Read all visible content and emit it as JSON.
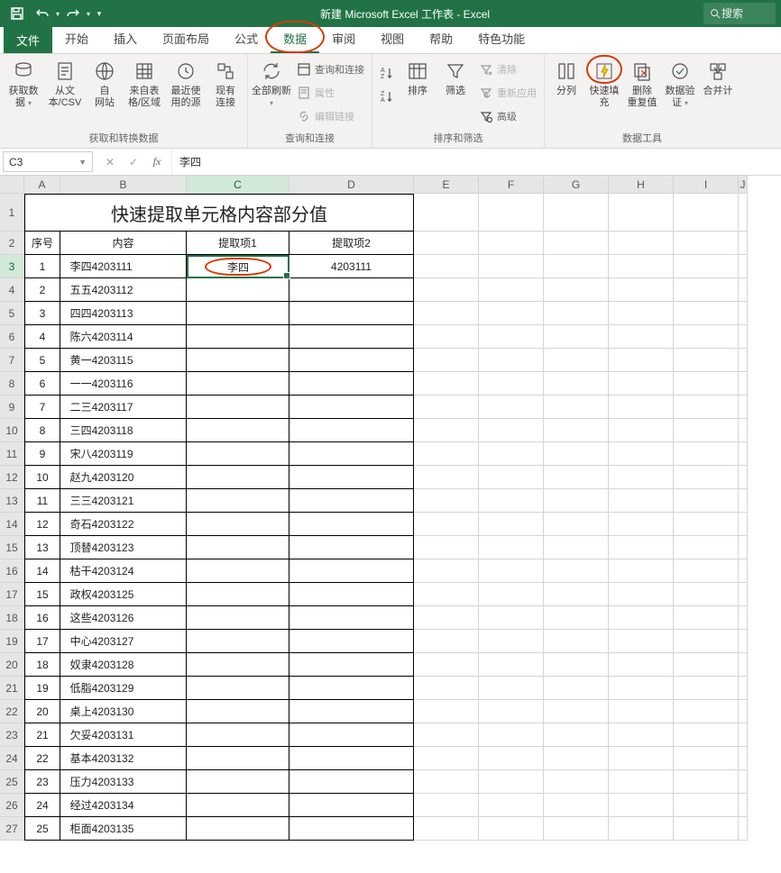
{
  "title_bar": {
    "title": "新建 Microsoft Excel 工作表  -  Excel",
    "search_placeholder": "搜索"
  },
  "tabs": {
    "file": "文件",
    "home": "开始",
    "insert": "插入",
    "layout": "页面布局",
    "formulas": "公式",
    "data": "数据",
    "review": "审阅",
    "view": "视图",
    "help": "帮助",
    "special": "特色功能"
  },
  "ribbon": {
    "grp_get": {
      "label": "获取和转换数据",
      "get_data1": "获取数",
      "get_data2": "据",
      "from_csv1": "从文",
      "from_csv2": "本/CSV",
      "from_web1": "自",
      "from_web2": "网站",
      "from_table1": "来自表",
      "from_table2": "格/区域",
      "recent1": "最近使",
      "recent2": "用的源",
      "existing1": "现有",
      "existing2": "连接"
    },
    "grp_query": {
      "label": "查询和连接",
      "refresh_all1": "全部刷新",
      "queries": "查询和连接",
      "properties": "属性",
      "edit_links": "编辑链接"
    },
    "grp_sort": {
      "label": "排序和筛选",
      "sort": "排序",
      "filter": "筛选",
      "clear": "清除",
      "reapply": "重新应用",
      "advanced": "高级"
    },
    "grp_tools": {
      "label": "数据工具",
      "text_to_col": "分列",
      "flash_fill": "快速填充",
      "remove_dup1": "删除",
      "remove_dup2": "重复值",
      "data_val1": "数据验",
      "data_val2": "证",
      "consolidate": "合并计"
    }
  },
  "name_box": "C3",
  "formula_value": "李四",
  "columns": [
    "A",
    "B",
    "C",
    "D",
    "E",
    "F",
    "G",
    "H",
    "I",
    "J"
  ],
  "sheet": {
    "title": "快速提取单元格内容部分值",
    "h_a": "序号",
    "h_b": "内容",
    "h_c": "提取项1",
    "h_d": "提取项2",
    "rows": [
      {
        "n": "1",
        "b": "李四4203111",
        "c": "李四",
        "d": "4203111"
      },
      {
        "n": "2",
        "b": "五五4203112",
        "c": "",
        "d": ""
      },
      {
        "n": "3",
        "b": "四四4203113",
        "c": "",
        "d": ""
      },
      {
        "n": "4",
        "b": "陈六4203114",
        "c": "",
        "d": ""
      },
      {
        "n": "5",
        "b": "黄一4203115",
        "c": "",
        "d": ""
      },
      {
        "n": "6",
        "b": "一一4203116",
        "c": "",
        "d": ""
      },
      {
        "n": "7",
        "b": "二三4203117",
        "c": "",
        "d": ""
      },
      {
        "n": "8",
        "b": "三四4203118",
        "c": "",
        "d": ""
      },
      {
        "n": "9",
        "b": "宋八4203119",
        "c": "",
        "d": ""
      },
      {
        "n": "10",
        "b": "赵九4203120",
        "c": "",
        "d": ""
      },
      {
        "n": "11",
        "b": "三三4203121",
        "c": "",
        "d": ""
      },
      {
        "n": "12",
        "b": "奇石4203122",
        "c": "",
        "d": ""
      },
      {
        "n": "13",
        "b": "顶替4203123",
        "c": "",
        "d": ""
      },
      {
        "n": "14",
        "b": "枯干4203124",
        "c": "",
        "d": ""
      },
      {
        "n": "15",
        "b": "政权4203125",
        "c": "",
        "d": ""
      },
      {
        "n": "16",
        "b": "这些4203126",
        "c": "",
        "d": ""
      },
      {
        "n": "17",
        "b": "中心4203127",
        "c": "",
        "d": ""
      },
      {
        "n": "18",
        "b": "奴隶4203128",
        "c": "",
        "d": ""
      },
      {
        "n": "19",
        "b": "低脂4203129",
        "c": "",
        "d": ""
      },
      {
        "n": "20",
        "b": "桌上4203130",
        "c": "",
        "d": ""
      },
      {
        "n": "21",
        "b": "欠妥4203131",
        "c": "",
        "d": ""
      },
      {
        "n": "22",
        "b": "基本4203132",
        "c": "",
        "d": ""
      },
      {
        "n": "23",
        "b": "压力4203133",
        "c": "",
        "d": ""
      },
      {
        "n": "24",
        "b": "经过4203134",
        "c": "",
        "d": ""
      },
      {
        "n": "25",
        "b": "柜面4203135",
        "c": "",
        "d": ""
      }
    ]
  }
}
